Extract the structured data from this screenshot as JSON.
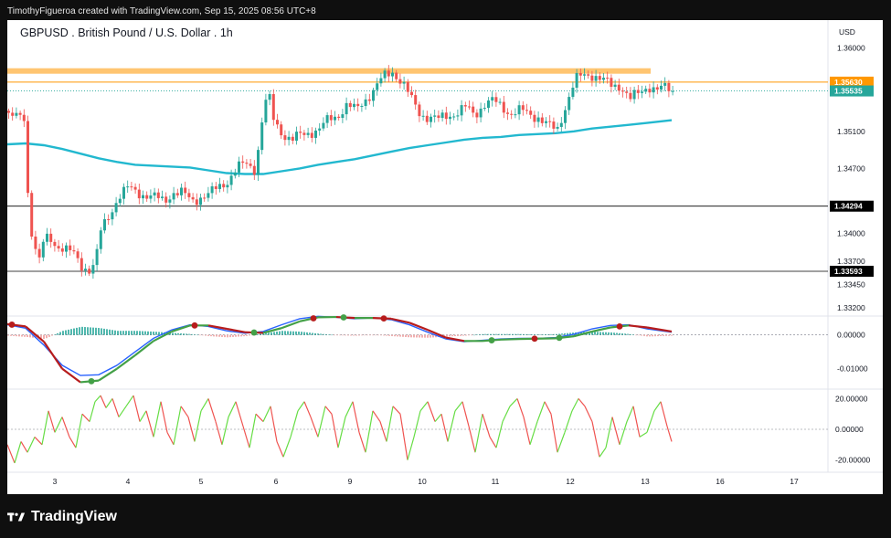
{
  "header": {
    "attribution": "TimothyFigueroa created with TradingView.com, Sep 15, 2025 08:56 UTC+8"
  },
  "chart_title": "GBPUSD . British Pound / U.S. Dollar . 1h",
  "footer": {
    "brand": "TradingView"
  },
  "colors": {
    "up": "#26a69a",
    "down": "#ef5350",
    "ma": "#22b8cf",
    "resistance_zone": "#ffb74d",
    "current_line": "#26a69a",
    "macd_fast": "#2962ff",
    "macd_green": "#43a047",
    "macd_red": "#b71c1c",
    "osc_up": "#4caf50",
    "osc_down": "#ef5350"
  },
  "chart_data": [
    {
      "type": "candlestick",
      "currency_label": "USD",
      "x_tick_labels": [
        "3",
        "4",
        "5",
        "6",
        "9",
        "10",
        "11",
        "12",
        "13",
        "16",
        "17"
      ],
      "y_tick_labels": [
        "1.36000",
        "1.35100",
        "1.34700",
        "1.34000",
        "1.33700",
        "1.33450",
        "1.33200"
      ],
      "ylim": [
        1.3315,
        1.3618
      ],
      "price_tags": [
        {
          "value": "USD",
          "kind": "unit"
        },
        {
          "value": "1.35630",
          "color": "#ff9800"
        },
        {
          "value": "1.35535",
          "color": "#26a69a"
        },
        {
          "value": "1.34294",
          "color": "#000000"
        },
        {
          "value": "1.33593",
          "color": "#000000"
        }
      ],
      "horizontal_levels": [
        1.3563,
        1.34294,
        1.33593
      ],
      "resistance_zone": [
        1.357,
        1.3575
      ],
      "ma_series": {
        "x": [
          0,
          20,
          40,
          60,
          80,
          100,
          120,
          140,
          160,
          180,
          200,
          220,
          240,
          260,
          280,
          300,
          320,
          340,
          360,
          380,
          400,
          420,
          440,
          460,
          480,
          500,
          520,
          540,
          560,
          580,
          600,
          620,
          640,
          660,
          680,
          700,
          727
        ],
        "y": [
          1.3496,
          1.3497,
          1.3495,
          1.3491,
          1.3486,
          1.3481,
          1.3477,
          1.3474,
          1.3473,
          1.3472,
          1.3471,
          1.3468,
          1.3465,
          1.3464,
          1.3464,
          1.3467,
          1.347,
          1.3474,
          1.3477,
          1.348,
          1.3484,
          1.3488,
          1.3492,
          1.3495,
          1.3498,
          1.3501,
          1.3503,
          1.3504,
          1.3506,
          1.3507,
          1.3508,
          1.351,
          1.3513,
          1.3515,
          1.3517,
          1.3519,
          1.3522
        ]
      },
      "price_path": {
        "x": [
          0,
          10,
          18,
          22,
          28,
          33,
          38,
          44,
          52,
          60,
          70,
          80,
          88,
          95,
          100,
          110,
          120,
          130,
          140,
          150,
          160,
          170,
          180,
          190,
          200,
          210,
          220,
          230,
          240,
          250,
          260,
          270,
          280,
          285,
          290,
          300,
          310,
          320,
          330,
          340,
          350,
          360,
          370,
          380,
          390,
          400,
          410,
          420,
          430,
          440,
          450,
          460,
          470,
          480,
          490,
          500,
          510,
          520,
          530,
          540,
          550,
          560,
          570,
          580,
          590,
          600,
          610,
          620,
          630,
          640,
          650,
          660,
          670,
          680,
          690,
          700,
          710,
          720,
          727
        ],
        "y": [
          1.3527,
          1.3524,
          1.3525,
          1.3418,
          1.339,
          1.3368,
          1.339,
          1.3395,
          1.3388,
          1.3385,
          1.3378,
          1.3365,
          1.3362,
          1.3368,
          1.34,
          1.342,
          1.344,
          1.3448,
          1.3445,
          1.3442,
          1.3438,
          1.3435,
          1.3445,
          1.3443,
          1.3435,
          1.344,
          1.3442,
          1.345,
          1.3458,
          1.347,
          1.3475,
          1.347,
          1.354,
          1.3546,
          1.3522,
          1.3508,
          1.35,
          1.3506,
          1.351,
          1.3512,
          1.3522,
          1.3528,
          1.3538,
          1.3532,
          1.3545,
          1.3555,
          1.3568,
          1.3575,
          1.3564,
          1.3545,
          1.353,
          1.3525,
          1.3522,
          1.3528,
          1.353,
          1.3535,
          1.3528,
          1.354,
          1.3542,
          1.3536,
          1.353,
          1.3532,
          1.3528,
          1.3526,
          1.3516,
          1.351,
          1.354,
          1.3565,
          1.357,
          1.3572,
          1.3565,
          1.3558,
          1.356,
          1.3545,
          1.355,
          1.356,
          1.3555,
          1.3556,
          1.3553
        ]
      }
    },
    {
      "type": "macd",
      "y_tick_labels": [
        "0.00000",
        "-0.01000"
      ],
      "zero_value": 0.0,
      "ylim": [
        -0.0155,
        0.0045
      ],
      "fast_line": {
        "x": [
          0,
          20,
          40,
          60,
          80,
          100,
          120,
          140,
          160,
          180,
          200,
          220,
          240,
          260,
          280,
          300,
          320,
          340,
          360,
          380,
          400,
          420,
          440,
          460,
          480,
          500,
          520,
          540,
          560,
          580,
          600,
          620,
          640,
          660,
          680,
          700,
          727
        ],
        "y": [
          0.003,
          0.002,
          -0.003,
          -0.009,
          -0.012,
          -0.0118,
          -0.009,
          -0.005,
          -0.001,
          0.0015,
          0.003,
          0.0025,
          0.0012,
          0.0005,
          0.001,
          0.003,
          0.0048,
          0.0055,
          0.0052,
          0.0048,
          0.005,
          0.0045,
          0.003,
          0.0008,
          -0.0012,
          -0.002,
          -0.0016,
          -0.0012,
          -0.001,
          -0.001,
          -0.0008,
          0.0002,
          0.0018,
          0.0028,
          0.003,
          0.0018,
          0.0008
        ]
      },
      "signal_line": {
        "x": [
          0,
          20,
          40,
          60,
          80,
          100,
          120,
          140,
          160,
          180,
          200,
          220,
          240,
          260,
          280,
          300,
          320,
          340,
          360,
          380,
          400,
          420,
          440,
          460,
          480,
          500,
          520,
          540,
          560,
          580,
          600,
          620,
          640,
          660,
          680,
          700,
          727
        ],
        "y": [
          0.0032,
          0.0025,
          -0.002,
          -0.01,
          -0.014,
          -0.0135,
          -0.01,
          -0.006,
          -0.0018,
          0.001,
          0.0028,
          0.0028,
          0.0018,
          0.0008,
          0.0006,
          0.002,
          0.004,
          0.0052,
          0.0053,
          0.005,
          0.005,
          0.0048,
          0.0036,
          0.0015,
          -0.0008,
          -0.0018,
          -0.0018,
          -0.0014,
          -0.0012,
          -0.0011,
          -0.001,
          -0.0004,
          0.001,
          0.0022,
          0.0028,
          0.0022,
          0.001
        ]
      },
      "cross_markers": [
        {
          "x": 5,
          "color": "#b71c1c"
        },
        {
          "x": 92,
          "color": "#43a047"
        },
        {
          "x": 205,
          "color": "#b71c1c"
        },
        {
          "x": 270,
          "color": "#43a047"
        },
        {
          "x": 335,
          "color": "#b71c1c"
        },
        {
          "x": 368,
          "color": "#43a047"
        },
        {
          "x": 412,
          "color": "#b71c1c"
        },
        {
          "x": 530,
          "color": "#43a047"
        },
        {
          "x": 577,
          "color": "#b71c1c"
        },
        {
          "x": 604,
          "color": "#43a047"
        },
        {
          "x": 670,
          "color": "#b71c1c"
        }
      ]
    },
    {
      "type": "oscillator",
      "y_tick_labels": [
        "20.00000",
        "0.00000",
        "-20.00000"
      ],
      "ylim": [
        -25,
        25
      ],
      "series": {
        "x": [
          0,
          8,
          15,
          22,
          30,
          38,
          45,
          52,
          60,
          68,
          75,
          82,
          90,
          96,
          102,
          108,
          115,
          122,
          130,
          138,
          145,
          152,
          160,
          168,
          175,
          182,
          190,
          198,
          205,
          212,
          220,
          228,
          235,
          242,
          250,
          258,
          265,
          272,
          280,
          288,
          295,
          302,
          310,
          318,
          325,
          332,
          340,
          348,
          355,
          362,
          370,
          378,
          385,
          392,
          400,
          408,
          415,
          422,
          430,
          438,
          445,
          452,
          460,
          468,
          475,
          482,
          490,
          498,
          505,
          512,
          520,
          528,
          535,
          542,
          550,
          558,
          565,
          572,
          580,
          588,
          595,
          602,
          610,
          618,
          625,
          632,
          640,
          648,
          655,
          662,
          670,
          678,
          685,
          692,
          700,
          708,
          715,
          722,
          727
        ],
        "y": [
          -10,
          -22,
          -8,
          -15,
          -5,
          -10,
          12,
          -2,
          8,
          -5,
          -12,
          10,
          5,
          18,
          22,
          14,
          20,
          8,
          15,
          22,
          5,
          12,
          -5,
          18,
          -2,
          -10,
          15,
          8,
          -8,
          12,
          20,
          5,
          -10,
          8,
          18,
          2,
          -12,
          10,
          5,
          15,
          -8,
          -18,
          -5,
          12,
          18,
          8,
          -5,
          15,
          10,
          -12,
          8,
          18,
          -2,
          -15,
          12,
          5,
          -8,
          15,
          10,
          -20,
          -5,
          12,
          18,
          5,
          10,
          -8,
          12,
          18,
          2,
          -15,
          10,
          -5,
          -12,
          5,
          15,
          20,
          8,
          -10,
          5,
          18,
          10,
          -15,
          -2,
          12,
          20,
          15,
          5,
          -18,
          -12,
          8,
          -10,
          5,
          15,
          -5,
          -2,
          12,
          18,
          2,
          -8
        ]
      }
    }
  ]
}
